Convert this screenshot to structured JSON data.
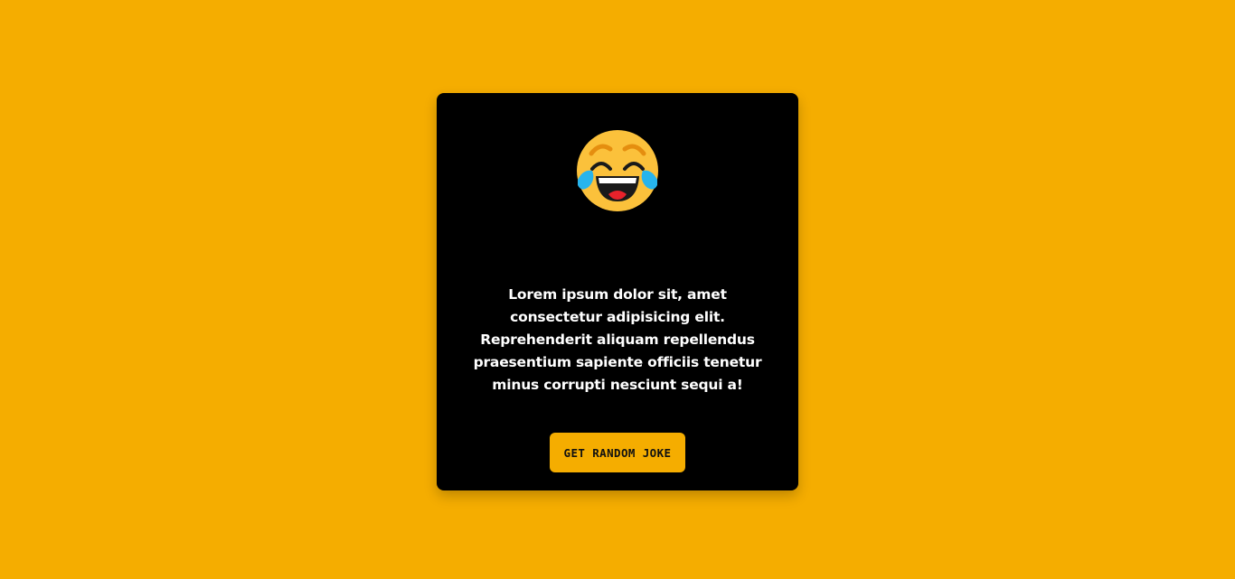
{
  "page": {
    "background_color": "#f5ad00"
  },
  "card": {
    "background_color": "#000000",
    "icon": "face-with-tears-of-joy-icon",
    "joke_text": "Lorem ipsum dolor sit, amet consectetur adipisicing elit. Reprehenderit aliquam repellendus praesentium sapiente officiis tenetur minus corrupti nesciunt sequi a!",
    "button_label": "GET RANDOM JOKE",
    "button_color": "#f5ad00"
  }
}
